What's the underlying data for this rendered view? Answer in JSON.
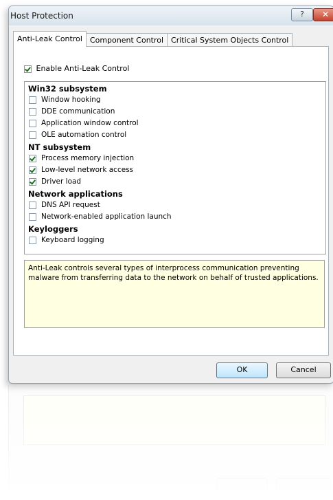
{
  "window": {
    "title": "Host Protection",
    "help_label": "?",
    "close_label": "✕"
  },
  "tabs": [
    {
      "label": "Anti-Leak Control",
      "active": true
    },
    {
      "label": "Component Control",
      "active": false
    },
    {
      "label": "Critical System Objects Control",
      "active": false
    }
  ],
  "enable": {
    "label": "Enable Anti-Leak Control",
    "checked": true
  },
  "groups": [
    {
      "title": "Win32 subsystem",
      "items": [
        {
          "label": "Window hooking",
          "checked": false
        },
        {
          "label": "DDE communication",
          "checked": false
        },
        {
          "label": "Application window control",
          "checked": false
        },
        {
          "label": "OLE automation control",
          "checked": false
        }
      ]
    },
    {
      "title": "NT subsystem",
      "items": [
        {
          "label": "Process memory injection",
          "checked": true
        },
        {
          "label": "Low-level network access",
          "checked": true
        },
        {
          "label": "Driver load",
          "checked": true
        }
      ]
    },
    {
      "title": "Network applications",
      "items": [
        {
          "label": "DNS API request",
          "checked": false
        },
        {
          "label": "Network-enabled application launch",
          "checked": false
        }
      ]
    },
    {
      "title": "Keyloggers",
      "items": [
        {
          "label": "Keyboard logging",
          "checked": false
        }
      ]
    }
  ],
  "description": "Anti-Leak controls several types of interprocess communication preventing malware from transferring data to the network on behalf of trusted applications.",
  "buttons": {
    "ok": "OK",
    "cancel": "Cancel"
  }
}
